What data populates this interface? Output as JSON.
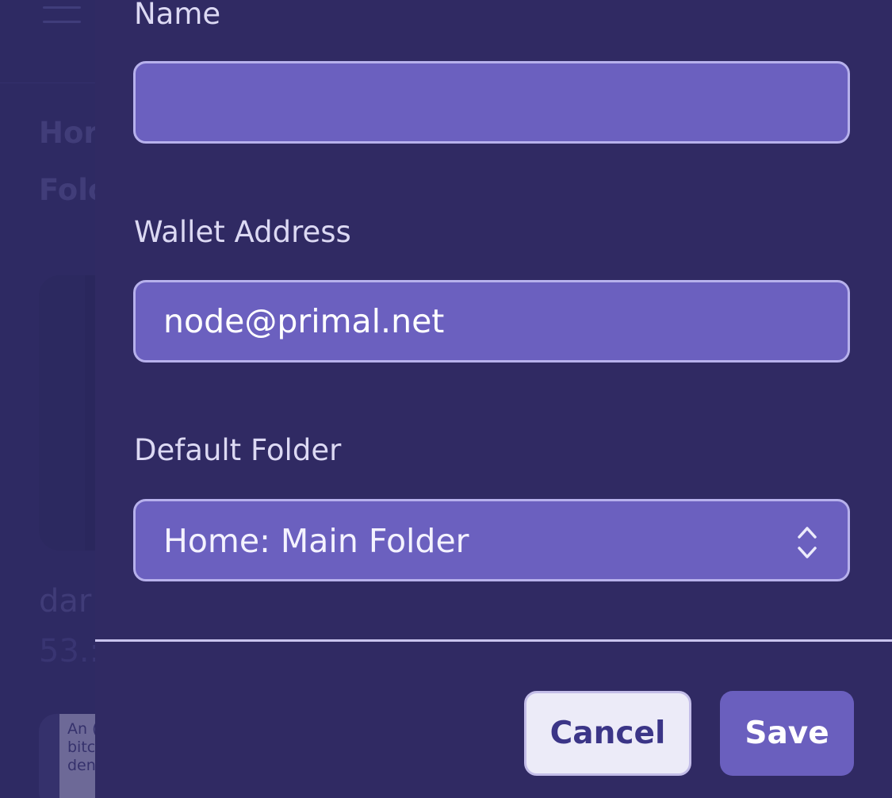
{
  "background": {
    "menu_icon": "hamburger-menu-icon",
    "nav": {
      "home": "Hor",
      "folders": "Folc"
    },
    "card": {
      "title": "dar",
      "amount": "53.:"
    },
    "card2": {
      "thumb_text": [
        "An (",
        "bitc",
        "den"
      ]
    }
  },
  "form": {
    "name": {
      "label": "Name",
      "value": ""
    },
    "wallet": {
      "label": "Wallet Address",
      "value": "node@primal.net"
    },
    "folder": {
      "label": "Default Folder",
      "value": "Home: Main Folder",
      "icon": "chevron-up-down-icon"
    }
  },
  "footer": {
    "cancel_label": "Cancel",
    "save_label": "Save"
  },
  "colors": {
    "page_background": "#2f2a63",
    "field_background": "#6b60bf",
    "field_border": "#b7b1ec",
    "label_text": "#dcd9f3",
    "primary_button": "#6a5fbe",
    "secondary_button": "#ecebf8",
    "secondary_button_text": "#3b3587"
  }
}
